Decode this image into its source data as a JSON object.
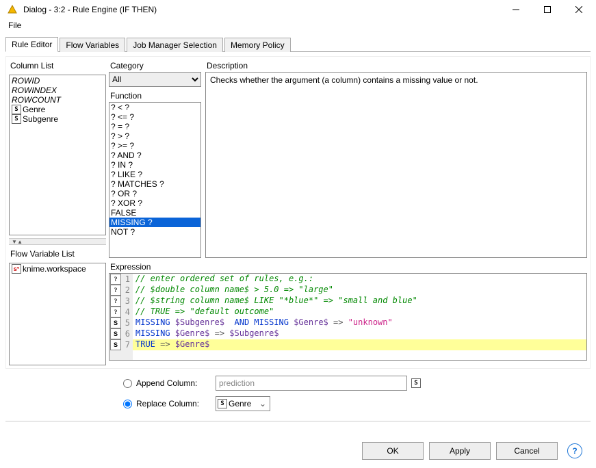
{
  "titlebar": {
    "title": "Dialog - 3:2 - Rule Engine (IF THEN)"
  },
  "menu": {
    "file": "File"
  },
  "tabs": [
    "Rule Editor",
    "Flow Variables",
    "Job Manager Selection",
    "Memory Policy"
  ],
  "active_tab": 0,
  "left_panels": {
    "column_list_label": "Column List",
    "column_list": {
      "builtins": [
        "ROWID",
        "ROWINDEX",
        "ROWCOUNT"
      ],
      "cols": [
        "Genre",
        "Subgenre"
      ]
    },
    "flow_var_label": "Flow Variable List",
    "flow_vars": [
      "knime.workspace"
    ]
  },
  "category_label": "Category",
  "category_value": "All",
  "function_label": "Function",
  "functions": [
    "? < ?",
    "? <= ?",
    "? = ?",
    "? > ?",
    "? >= ?",
    "? AND ?",
    "? IN ?",
    "? LIKE ?",
    "? MATCHES ?",
    "? OR ?",
    "? XOR ?",
    "FALSE",
    "MISSING ?",
    "NOT ?"
  ],
  "function_selected_index": 12,
  "description_label": "Description",
  "description_text": "Checks whether the argument (a column) contains a missing value or not.",
  "expression_label": "Expression",
  "code_lines": [
    {
      "n": 1,
      "icon": "?",
      "html": [
        {
          "cls": "c-comment",
          "t": "// enter ordered set of rules, e.g.:"
        }
      ]
    },
    {
      "n": 2,
      "icon": "?",
      "html": [
        {
          "cls": "c-comment",
          "t": "// $double column name$ > 5.0 => \"large\""
        }
      ]
    },
    {
      "n": 3,
      "icon": "?",
      "html": [
        {
          "cls": "c-comment",
          "t": "// $string column name$ LIKE \"*blue*\" => \"small and blue\""
        }
      ]
    },
    {
      "n": 4,
      "icon": "?",
      "html": [
        {
          "cls": "c-comment",
          "t": "// TRUE => \"default outcome\""
        }
      ]
    },
    {
      "n": 5,
      "icon": "S",
      "html": [
        {
          "cls": "c-kw",
          "t": "MISSING "
        },
        {
          "cls": "c-col",
          "t": "$Subgenre$"
        },
        {
          "cls": "",
          "t": "  "
        },
        {
          "cls": "c-kw",
          "t": "AND MISSING "
        },
        {
          "cls": "c-col",
          "t": "$Genre$"
        },
        {
          "cls": "",
          "t": " "
        },
        {
          "cls": "c-arrow",
          "t": "=>"
        },
        {
          "cls": "",
          "t": " "
        },
        {
          "cls": "c-str",
          "t": "\"unknown\""
        }
      ]
    },
    {
      "n": 6,
      "icon": "S",
      "html": [
        {
          "cls": "c-kw",
          "t": "MISSING "
        },
        {
          "cls": "c-col",
          "t": "$Genre$"
        },
        {
          "cls": "",
          "t": " "
        },
        {
          "cls": "c-arrow",
          "t": "=>"
        },
        {
          "cls": "",
          "t": " "
        },
        {
          "cls": "c-col",
          "t": "$Subgenre$"
        }
      ]
    },
    {
      "n": 7,
      "icon": "S",
      "hl": true,
      "html": [
        {
          "cls": "c-kw",
          "t": "TRUE"
        },
        {
          "cls": "",
          "t": " "
        },
        {
          "cls": "c-arrow",
          "t": "=>"
        },
        {
          "cls": "",
          "t": " "
        },
        {
          "cls": "c-col",
          "t": "$Genre$"
        }
      ]
    }
  ],
  "append_label": "Append Column:",
  "append_value": "prediction",
  "replace_label": "Replace Column:",
  "replace_value": "Genre",
  "buttons": {
    "ok": "OK",
    "apply": "Apply",
    "cancel": "Cancel"
  }
}
